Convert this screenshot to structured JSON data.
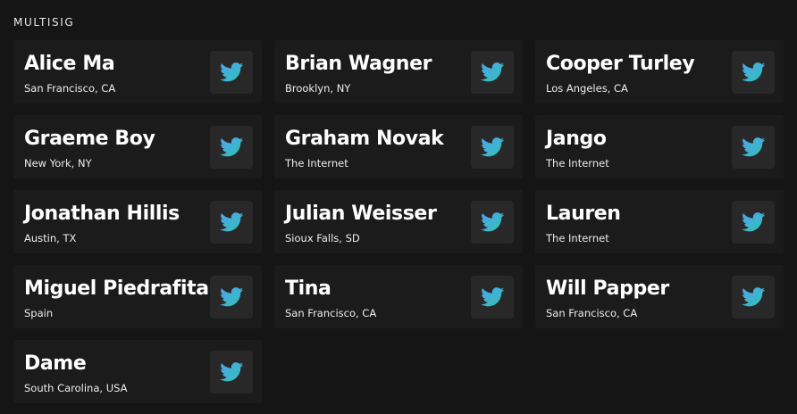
{
  "section": {
    "title": "MULTISIG"
  },
  "members": [
    {
      "name": "Alice Ma",
      "location": "San Francisco, CA",
      "icon": "twitter-icon"
    },
    {
      "name": "Brian Wagner",
      "location": "Brooklyn, NY",
      "icon": "twitter-icon"
    },
    {
      "name": "Cooper Turley",
      "location": "Los Angeles, CA",
      "icon": "twitter-icon"
    },
    {
      "name": "Graeme Boy",
      "location": "New York, NY",
      "icon": "twitter-icon"
    },
    {
      "name": "Graham Novak",
      "location": "The Internet",
      "icon": "twitter-icon"
    },
    {
      "name": "Jango",
      "location": "The Internet",
      "icon": "twitter-icon"
    },
    {
      "name": "Jonathan Hillis",
      "location": "Austin, TX",
      "icon": "twitter-icon"
    },
    {
      "name": "Julian Weisser",
      "location": "Sioux Falls, SD",
      "icon": "twitter-icon"
    },
    {
      "name": "Lauren",
      "location": "The Internet",
      "icon": "twitter-icon"
    },
    {
      "name": "Miguel Piedrafita",
      "location": "Spain",
      "icon": "twitter-icon"
    },
    {
      "name": "Tina",
      "location": "San Francisco, CA",
      "icon": "twitter-icon"
    },
    {
      "name": "Will Papper",
      "location": "San Francisco, CA",
      "icon": "twitter-icon"
    },
    {
      "name": "Dame",
      "location": "South Carolina, USA",
      "icon": "twitter-icon"
    }
  ],
  "colors": {
    "background": "#151515",
    "card": "#1b1b1b",
    "icon_button": "#282828",
    "twitter_gradient_start": "#4fa3f0",
    "twitter_gradient_end": "#2fc2b0"
  }
}
